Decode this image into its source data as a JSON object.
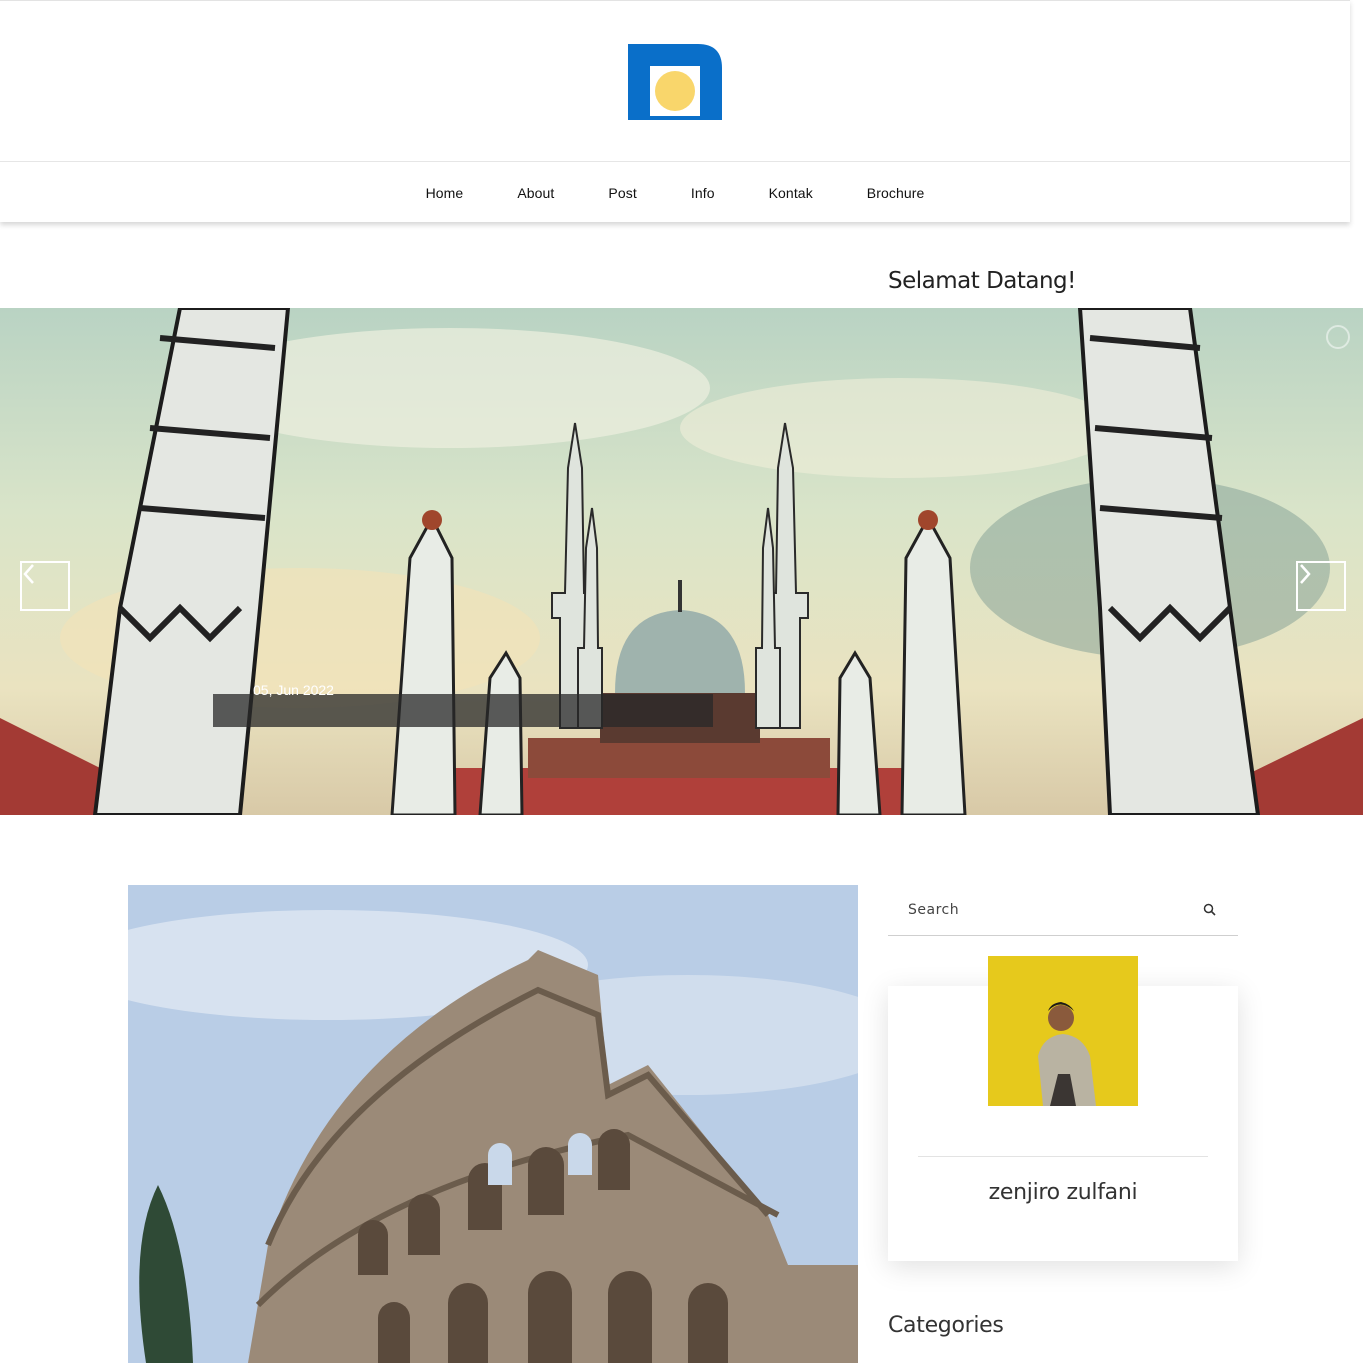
{
  "nav": {
    "items": [
      "Home",
      "About",
      "Post",
      "Info",
      "Kontak",
      "Brochure"
    ]
  },
  "welcome": "Selamat Datang!",
  "slider": {
    "caption_date": "05, Jun 2022",
    "prev_icon": "chevron-left-icon",
    "next_icon": "chevron-right-icon"
  },
  "sidebar": {
    "search_placeholder": "Search",
    "search_icon": "search-icon",
    "author_name": "zenjiro zulfani",
    "categories_title": "Categories"
  },
  "colors": {
    "logo_blue": "#0a6fc9",
    "logo_yellow": "#f9d66b",
    "avatar_bg": "#e6c91c"
  }
}
